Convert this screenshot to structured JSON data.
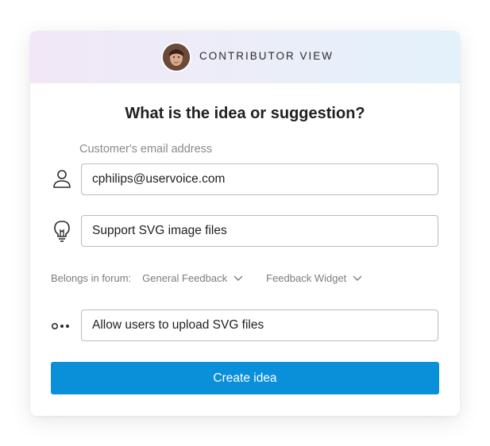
{
  "header": {
    "title": "CONTRIBUTOR VIEW"
  },
  "form": {
    "question": "What is the idea or suggestion?",
    "email_label": "Customer's email address",
    "email_value": "cphilips@uservoice.com",
    "idea_title_value": "Support SVG image files",
    "forum_label": "Belongs in forum:",
    "forum_select": "General Feedback",
    "category_select": "Feedback Widget",
    "description_value": "Allow users to upload SVG files",
    "submit_label": "Create idea"
  },
  "icons": {
    "email_row": "person-icon",
    "title_row": "lightbulb-icon",
    "description_row": "more-dots-icon",
    "select_arrow": "chevron-down-icon"
  },
  "colors": {
    "accent": "#0a8fd9",
    "header_gradient_left": "#f1e7f6",
    "header_gradient_right": "#e3f1fa"
  }
}
